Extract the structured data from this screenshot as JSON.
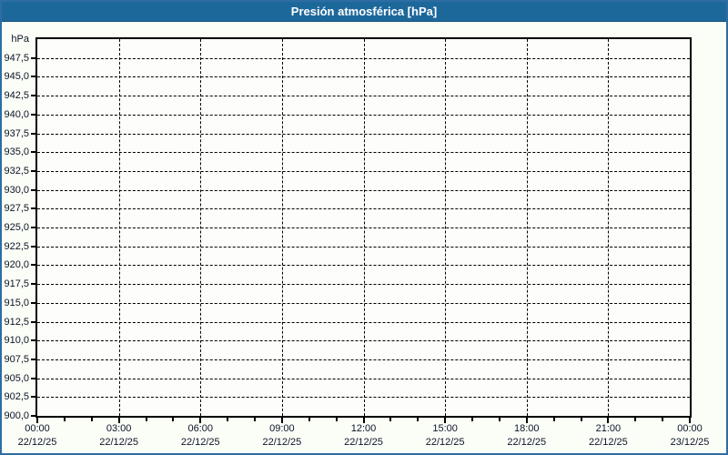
{
  "window": {
    "title": "Presión atmosférica [hPa]"
  },
  "colors": {
    "titlebar_bg": "#1d689b",
    "titlebar_text": "#ffffff",
    "frame_border": "#2e6da3",
    "page_bg": "#fbfdf7",
    "plot_bg": "#fdfefb",
    "axis": "#000000",
    "grid": "#000000",
    "text": "#0b1526"
  },
  "chart_data": {
    "type": "line",
    "title": "Presión atmosférica [hPa]",
    "unit_label": "hPa",
    "ylabel": "hPa",
    "ylim": [
      900,
      950
    ],
    "ytick_step": 2.5,
    "grid": "dashed",
    "legend": "none",
    "series": [],
    "yticks": [
      {
        "label": "947,5",
        "value": 947.5
      },
      {
        "label": "945,0",
        "value": 945.0
      },
      {
        "label": "942,5",
        "value": 942.5
      },
      {
        "label": "940,0",
        "value": 940.0
      },
      {
        "label": "937,5",
        "value": 937.5
      },
      {
        "label": "935,0",
        "value": 935.0
      },
      {
        "label": "932,5",
        "value": 932.5
      },
      {
        "label": "930,0",
        "value": 930.0
      },
      {
        "label": "927,5",
        "value": 927.5
      },
      {
        "label": "925,0",
        "value": 925.0
      },
      {
        "label": "922,5",
        "value": 922.5
      },
      {
        "label": "920,0",
        "value": 920.0
      },
      {
        "label": "917,5",
        "value": 917.5
      },
      {
        "label": "915,0",
        "value": 915.0
      },
      {
        "label": "912,5",
        "value": 912.5
      },
      {
        "label": "910,0",
        "value": 910.0
      },
      {
        "label": "907,5",
        "value": 907.5
      },
      {
        "label": "905,0",
        "value": 905.0
      },
      {
        "label": "902,5",
        "value": 902.5
      },
      {
        "label": "900,0",
        "value": 900.0
      }
    ],
    "x_axis": {
      "range_hours": [
        0,
        24
      ],
      "minor_tick_hours": 1,
      "major_ticks": [
        {
          "hour": 0,
          "time": "00:00",
          "date": "22/12/25"
        },
        {
          "hour": 3,
          "time": "03:00",
          "date": "22/12/25"
        },
        {
          "hour": 6,
          "time": "06:00",
          "date": "22/12/25"
        },
        {
          "hour": 9,
          "time": "09:00",
          "date": "22/12/25"
        },
        {
          "hour": 12,
          "time": "12:00",
          "date": "22/12/25"
        },
        {
          "hour": 15,
          "time": "15:00",
          "date": "22/12/25"
        },
        {
          "hour": 18,
          "time": "18:00",
          "date": "22/12/25"
        },
        {
          "hour": 21,
          "time": "21:00",
          "date": "22/12/25"
        },
        {
          "hour": 24,
          "time": "00:00",
          "date": "23/12/25"
        }
      ]
    }
  }
}
